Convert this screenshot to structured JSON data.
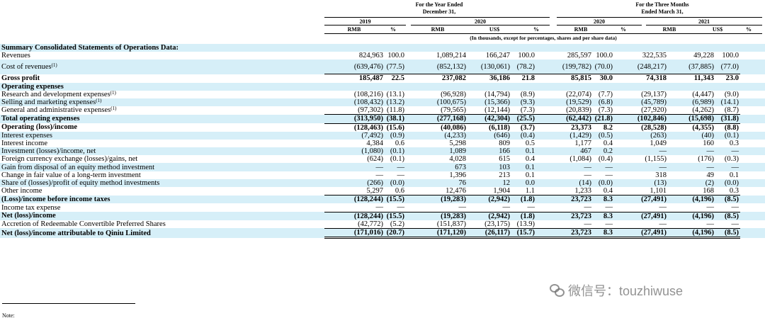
{
  "header": {
    "group_year": "For the Year Ended\nDecember 31,",
    "group_three_months": "For the Three Months\nEnded March 31,",
    "years": [
      "2019",
      "2020",
      "2020",
      "2021"
    ],
    "units": [
      "RMB",
      "%",
      "RMB",
      "US$",
      "%",
      "RMB",
      "%",
      "RMB",
      "US$",
      "%"
    ],
    "note_units": "(In thousands, except for percentages, shares and per share data)"
  },
  "rows": [
    {
      "label": "Summary Consolidated Statements of Operations Data:",
      "sup": "",
      "bold": true,
      "shade": true,
      "line": "",
      "values": [
        "",
        "",
        "",
        "",
        "",
        "",
        "",
        "",
        "",
        ""
      ]
    },
    {
      "label": "Revenues",
      "sup": "",
      "bold": false,
      "shade": false,
      "line": "",
      "values": [
        "824,963",
        "100.0",
        "1,089,214",
        "166,247",
        "100.0",
        "285,597",
        "100.0",
        "322,535",
        "49,228",
        "100.0"
      ]
    },
    {
      "label": "Cost of revenues",
      "sup": "(1)",
      "bold": false,
      "shade": true,
      "line": "ul",
      "tall": true,
      "values": [
        "(639,476)",
        "(77.5)",
        "(852,132)",
        "(130,061)",
        "(78.2)",
        "(199,782)",
        "(70.0)",
        "(248,217)",
        "(37,885)",
        "(77.0)"
      ]
    },
    {
      "label": "Gross profit",
      "sup": "",
      "bold": true,
      "shade": false,
      "line": "",
      "values": [
        "185,487",
        "22.5",
        "237,082",
        "36,186",
        "21.8",
        "85,815",
        "30.0",
        "74,318",
        "11,343",
        "23.0"
      ]
    },
    {
      "label": "Operating expenses",
      "sup": "",
      "bold": true,
      "shade": true,
      "line": "",
      "values": [
        "",
        "",
        "",
        "",
        "",
        "",
        "",
        "",
        "",
        ""
      ]
    },
    {
      "label": "Research and development expenses",
      "sup": "(1)",
      "bold": false,
      "shade": false,
      "line": "",
      "values": [
        "(108,216)",
        "(13.1)",
        "(96,928)",
        "(14,794)",
        "(8.9)",
        "(22,074)",
        "(7.7)",
        "(29,137)",
        "(4,447)",
        "(9.0)"
      ]
    },
    {
      "label": "Selling and marketing expenses",
      "sup": "(1)",
      "bold": false,
      "shade": true,
      "line": "",
      "values": [
        "(108,432)",
        "(13.2)",
        "(100,675)",
        "(15,366)",
        "(9.3)",
        "(19,529)",
        "(6.8)",
        "(45,789)",
        "(6,989)",
        "(14.1)"
      ]
    },
    {
      "label": "General and administrative expenses",
      "sup": "(1)",
      "bold": false,
      "shade": false,
      "line": "ul",
      "values": [
        "(97,302)",
        "(11.8)",
        "(79,565)",
        "(12,144)",
        "(7.3)",
        "(20,839)",
        "(7.3)",
        "(27,920)",
        "(4,262)",
        "(8.7)"
      ]
    },
    {
      "label": "Total operating expenses",
      "sup": "",
      "bold": true,
      "shade": true,
      "line": "ul",
      "values": [
        "(313,950)",
        "(38.1)",
        "(277,168)",
        "(42,304)",
        "(25.5)",
        "(62,442)",
        "(21.8)",
        "(102,846)",
        "(15,698)",
        "(31.8)"
      ]
    },
    {
      "label": "Operating (loss)/income",
      "sup": "",
      "bold": true,
      "shade": false,
      "line": "",
      "values": [
        "(128,463)",
        "(15.6)",
        "(40,086)",
        "(6,118)",
        "(3.7)",
        "23,373",
        "8.2",
        "(28,528)",
        "(4,355)",
        "(8.8)"
      ]
    },
    {
      "label": "Interest expenses",
      "sup": "",
      "bold": false,
      "shade": true,
      "line": "",
      "values": [
        "(7,492)",
        "(0.9)",
        "(4,233)",
        "(646)",
        "(0.4)",
        "(1,429)",
        "(0.5)",
        "(263)",
        "(40)",
        "(0.1)"
      ]
    },
    {
      "label": "Interest income",
      "sup": "",
      "bold": false,
      "shade": false,
      "line": "",
      "values": [
        "4,384",
        "0.6",
        "5,298",
        "809",
        "0.5",
        "1,177",
        "0.4",
        "1,049",
        "160",
        "0.3"
      ]
    },
    {
      "label": "Investment (losses)/income, net",
      "sup": "",
      "bold": false,
      "shade": true,
      "line": "",
      "values": [
        "(1,080)",
        "(0.1)",
        "1,089",
        "166",
        "0.1",
        "467",
        "0.2",
        "—",
        "—",
        "—"
      ]
    },
    {
      "label": "Foreign currency exchange (losses)/gains, net",
      "sup": "",
      "bold": false,
      "shade": false,
      "line": "",
      "values": [
        "(624)",
        "(0.1)",
        "4,028",
        "615",
        "0.4",
        "(1,084)",
        "(0.4)",
        "(1,155)",
        "(176)",
        "(0.3)"
      ]
    },
    {
      "label": "Gain from disposal of an equity method investment",
      "sup": "",
      "bold": false,
      "shade": true,
      "line": "",
      "values": [
        "—",
        "—",
        "673",
        "103",
        "0.1",
        "—",
        "—",
        "—",
        "—",
        "—"
      ]
    },
    {
      "label": "Change in fair value of a long-term investment",
      "sup": "",
      "bold": false,
      "shade": false,
      "line": "",
      "values": [
        "—",
        "—",
        "1,396",
        "213",
        "0.1",
        "—",
        "—",
        "318",
        "49",
        "0.1"
      ]
    },
    {
      "label": "Share of (losses)/profit of equity method investments",
      "sup": "",
      "bold": false,
      "shade": true,
      "line": "",
      "values": [
        "(266)",
        "(0.0)",
        "76",
        "12",
        "0.0",
        "(14)",
        "(0.0)",
        "(13)",
        "(2)",
        "(0.0)"
      ]
    },
    {
      "label": "Other income",
      "sup": "",
      "bold": false,
      "shade": false,
      "line": "ul",
      "values": [
        "5,297",
        "0.6",
        "12,476",
        "1,904",
        "1.1",
        "1,233",
        "0.4",
        "1,101",
        "168",
        "0.3"
      ]
    },
    {
      "label": "(Loss)/income before income taxes",
      "sup": "",
      "bold": true,
      "shade": true,
      "line": "",
      "values": [
        "(128,244)",
        "(15.5)",
        "(19,283)",
        "(2,942)",
        "(1.8)",
        "23,723",
        "8.3",
        "(27,491)",
        "(4,196)",
        "(8.5)"
      ]
    },
    {
      "label": "Income tax expense",
      "sup": "",
      "bold": false,
      "shade": false,
      "line": "ul",
      "values": [
        "—",
        "—",
        "—",
        "—",
        "—",
        "—",
        "—",
        "—",
        "—",
        "—"
      ]
    },
    {
      "label": "Net (loss)/income",
      "sup": "",
      "bold": true,
      "shade": true,
      "line": "",
      "values": [
        "(128,244)",
        "(15.5)",
        "(19,283)",
        "(2,942)",
        "(1.8)",
        "23,723",
        "8.3",
        "(27,491)",
        "(4,196)",
        "(8.5)"
      ]
    },
    {
      "label": "Accretion of Redeemable Convertible Preferred Shares",
      "sup": "",
      "bold": false,
      "shade": false,
      "line": "ul",
      "values": [
        "(42,772)",
        "(5.2)",
        "(151,837)",
        "(23,175)",
        "(13.9)",
        "—",
        "—",
        "—",
        "—",
        "—"
      ]
    },
    {
      "label": "Net (loss)/income attributable to Qiniu Limited",
      "sup": "",
      "bold": true,
      "shade": true,
      "line": "dul",
      "values": [
        "(171,016)",
        "(20.7)",
        "(171,120)",
        "(26,117)",
        "(15.7)",
        "23,723",
        "8.3",
        "(27,491)",
        "(4,196)",
        "(8.5)"
      ]
    }
  ],
  "note": "Note:",
  "watermark": "微信号：touzhiwuse"
}
